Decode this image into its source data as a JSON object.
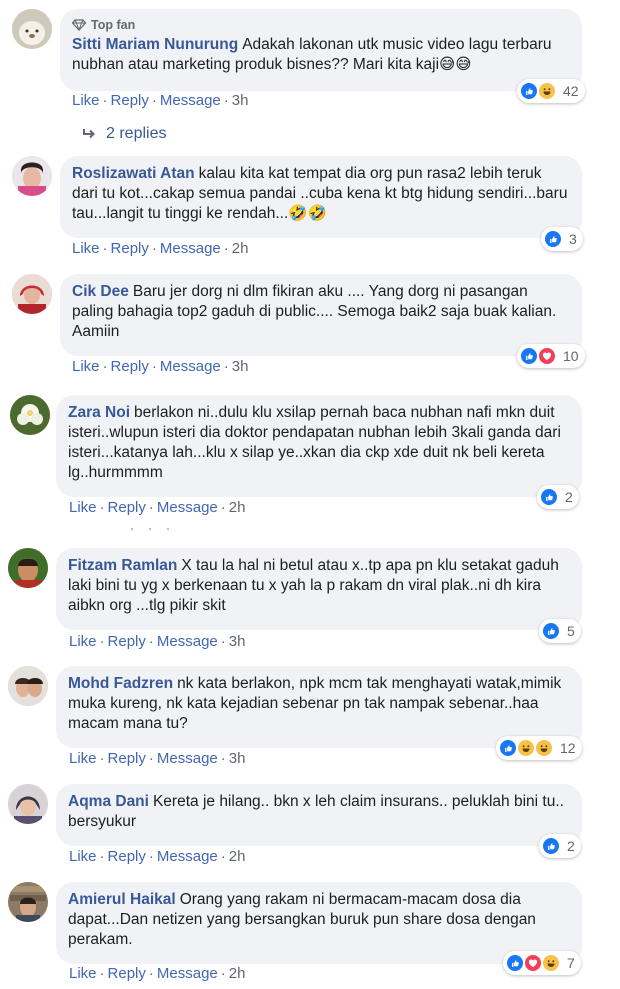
{
  "actions": {
    "like": "Like",
    "reply": "Reply",
    "message": "Message"
  },
  "top_fan_badge": "Top fan",
  "replies_link": "2 replies",
  "comments": [
    {
      "author": "Sitti Mariam Nunurung",
      "text": "Adakah lakonan utk music video lagu terbaru nubhan atau marketing produk bisnes?? Mari kita kaji😅😅",
      "time": "3h",
      "reactions": [
        "like",
        "haha"
      ],
      "count": "42"
    },
    {
      "author": "Roslizawati Atan",
      "text": "kalau kita kat tempat dia org pun rasa2 lebih teruk dari tu kot...cakap semua pandai ..cuba kena kt btg hidung sendiri...baru tau...langit tu tinggi ke rendah...🤣🤣",
      "time": "2h",
      "reactions": [
        "like"
      ],
      "count": "3"
    },
    {
      "author": "Cik Dee",
      "text": "Baru jer dorg ni dlm fikiran aku .... Yang dorg ni pasangan paling bahagia top2 gaduh di public.... Semoga baik2 saja buak kalian. Aamiin",
      "time": "3h",
      "reactions": [
        "like",
        "love"
      ],
      "count": "10"
    },
    {
      "author": "Zara Noi",
      "text": "berlakon ni..dulu klu xsilap pernah baca nubhan nafi mkn duit isteri..wlupun isteri dia doktor pendapatan nubhan lebih 3kali ganda dari isteri...katanya lah...klu x silap ye..xkan dia ckp xde duit nk beli kereta lg..hurmmmm",
      "time": "2h",
      "reactions": [
        "like"
      ],
      "count": "2"
    },
    {
      "author": "Fitzam Ramlan",
      "text": "X tau la hal ni betul atau x..tp apa pn klu setakat gaduh laki bini tu yg x berkenaan tu x yah la p rakam dn viral plak..ni dh kira aibkn org ...tlg pikir skit",
      "time": "3h",
      "reactions": [
        "like"
      ],
      "count": "5"
    },
    {
      "author": "Mohd Fadzren",
      "text": "nk kata berlakon, npk mcm tak menghayati watak,mimik muka kureng, nk kata kejadian sebenar pn tak nampak sebenar..haa macam mana tu?",
      "time": "3h",
      "reactions": [
        "like",
        "haha",
        "haha"
      ],
      "count": "12"
    },
    {
      "author": "Aqma Dani",
      "text": "Kereta je hilang.. bkn x leh claim insurans.. peluklah bini tu.. bersyukur",
      "time": "2h",
      "reactions": [
        "like"
      ],
      "count": "2"
    },
    {
      "author": "Amierul Haikal",
      "text": "Orang yang rakam ni bermacam-macam dosa dia dapat...Dan netizen yang bersangkan buruk pun share dosa dengan perakam.",
      "time": "2h",
      "reactions": [
        "like",
        "love",
        "haha"
      ],
      "count": "7"
    }
  ]
}
